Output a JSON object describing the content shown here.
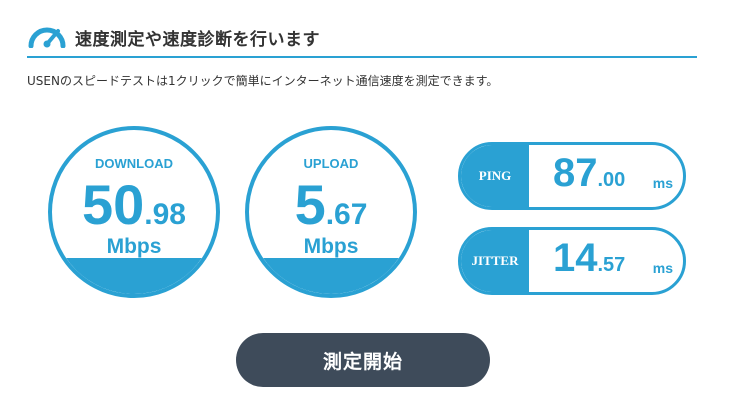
{
  "header": {
    "icon": "speedometer-icon",
    "title": "速度測定や速度診断を行います"
  },
  "description": "USENのスピードテストは1クリックで簡単にインターネット通信速度を測定できます。",
  "download": {
    "label": "DOWNLOAD",
    "int": "50",
    "dec": ".98",
    "unit": "Mbps"
  },
  "upload": {
    "label": "UPLOAD",
    "int": "5",
    "dec": ".67",
    "unit": "Mbps"
  },
  "ping": {
    "label": "PING",
    "int": "87",
    "dec": ".00",
    "unit": "ms"
  },
  "jitter": {
    "label": "JITTER",
    "int": "14",
    "dec": ".57",
    "unit": "ms"
  },
  "start_button": "測定開始",
  "colors": {
    "accent": "#2aa1d3",
    "button": "#3e4b5a",
    "text": "#333333"
  }
}
